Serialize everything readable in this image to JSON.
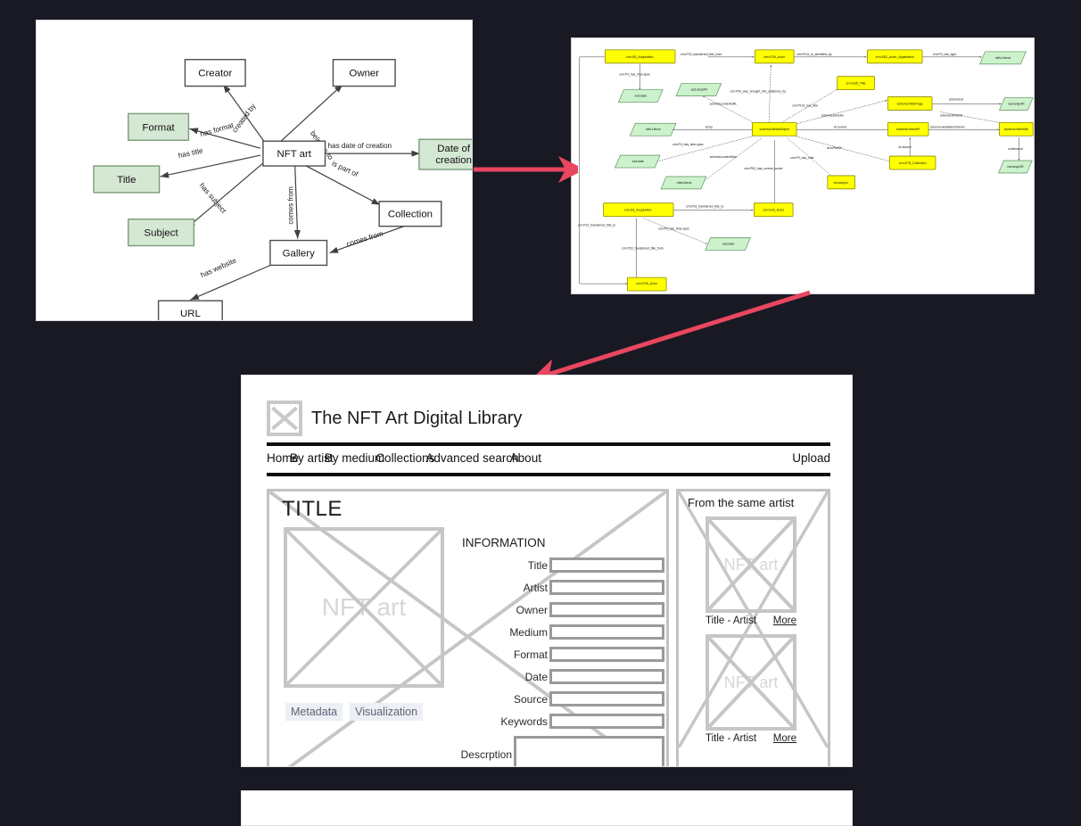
{
  "canvas": {
    "background": "#191924",
    "accent_arrow": "#e8475f"
  },
  "ontology_diagram": {
    "nodes": [
      {
        "id": "creator",
        "label": "Creator",
        "style": "plain"
      },
      {
        "id": "owner",
        "label": "Owner",
        "style": "plain"
      },
      {
        "id": "format",
        "label": "Format",
        "style": "green"
      },
      {
        "id": "title",
        "label": "Title",
        "style": "green"
      },
      {
        "id": "subject",
        "label": "Subject",
        "style": "green"
      },
      {
        "id": "nft",
        "label": "NFT art",
        "style": "plain"
      },
      {
        "id": "date",
        "label": "Date of creation",
        "style": "green"
      },
      {
        "id": "coll",
        "label": "Collection",
        "style": "plain"
      },
      {
        "id": "gallery",
        "label": "Gallery",
        "style": "plain"
      },
      {
        "id": "url",
        "label": "URL",
        "style": "plain"
      }
    ],
    "edges": [
      {
        "from": "nft",
        "to": "creator",
        "label": "created by"
      },
      {
        "from": "nft",
        "to": "owner",
        "label": "belongs to"
      },
      {
        "from": "nft",
        "to": "format",
        "label": "has format"
      },
      {
        "from": "nft",
        "to": "title",
        "label": "has title"
      },
      {
        "from": "nft",
        "to": "subject",
        "label": "has subject"
      },
      {
        "from": "nft",
        "to": "date",
        "label": "has date of creation"
      },
      {
        "from": "nft",
        "to": "coll",
        "label": "is part of"
      },
      {
        "from": "nft",
        "to": "gallery",
        "label": "comes from"
      },
      {
        "from": "coll",
        "to": "gallery",
        "label": "comes from"
      },
      {
        "from": "gallery",
        "to": "url",
        "label": "has website"
      }
    ]
  },
  "rdf_diagram": {
    "classes": [
      "crm:E8_Acquisition",
      "crm:E39_Actor",
      "crm:E82_Actor_Appellation",
      "crm:E35_Title",
      "schema:MediaObject",
      "schema:WebPage",
      "schema:WebAPI",
      "schema:WebSite",
      "crm:E78_Collection",
      "dc:subject",
      "crm:E8_Acquisition",
      "crm:E39_Actor",
      "crm:E39_Actor"
    ],
    "literals": [
      "rdfs:Literal",
      "xsd:date",
      "xsd:anyURI",
      "rdfs:Literal",
      "xsd:date",
      "rdfs:Literal",
      "xsd:date",
      "xsd:anyURI",
      "xsd:anyURI"
    ],
    "properties": [
      "crm:P23_transferred_title_from",
      "crm:P131_is_identified_by",
      "crm:P2_has_type",
      "crm:P4_has_time-span",
      "crm:P92_was_brought_into_existence_by",
      "crm:P102_has_title",
      "schema:contentURL",
      "schema:sameAs",
      "schema:url",
      "schema:isPartOf",
      "dc:by",
      "dc:source",
      "schema:availableChannel",
      "dc:isPartOf",
      "dc:source",
      "crm:P4_has_time-span",
      "schema:contentSize",
      "crm:P52_has_current_owner",
      "crm:P3_has_note",
      "crm:P22_transferred_title_to",
      "crm:P4_has_time-span",
      "crm:P22_transferred_title_from",
      "crm:P22_transferred_title_to",
      "schema:url"
    ]
  },
  "wireframe": {
    "site_title": "The NFT Art Digital Library",
    "nav": {
      "items": [
        "Home",
        "By artist",
        "By medium",
        "Collections",
        "Advanced search",
        "About"
      ],
      "upload_label": "Upload"
    },
    "main": {
      "page_title": "TITLE",
      "image_placeholder": "NFT art",
      "buttons": [
        "Metadata",
        "Visualization"
      ],
      "information_heading": "INFORMATION",
      "fields": [
        {
          "label": "Title",
          "value": ""
        },
        {
          "label": "Artist",
          "value": ""
        },
        {
          "label": "Owner",
          "value": ""
        },
        {
          "label": "Medium",
          "value": ""
        },
        {
          "label": "Format",
          "value": ""
        },
        {
          "label": "Date",
          "value": ""
        },
        {
          "label": "Source",
          "value": ""
        },
        {
          "label": "Keywords",
          "value": ""
        },
        {
          "label": "Descrption",
          "value": ""
        }
      ]
    },
    "sidebar": {
      "heading": "From the same artist",
      "cards": [
        {
          "placeholder": "NFT art",
          "caption": "Title - Artist",
          "more_label": "More"
        },
        {
          "placeholder": "NFT art",
          "caption": "Title - Artist",
          "more_label": "More"
        }
      ]
    }
  }
}
